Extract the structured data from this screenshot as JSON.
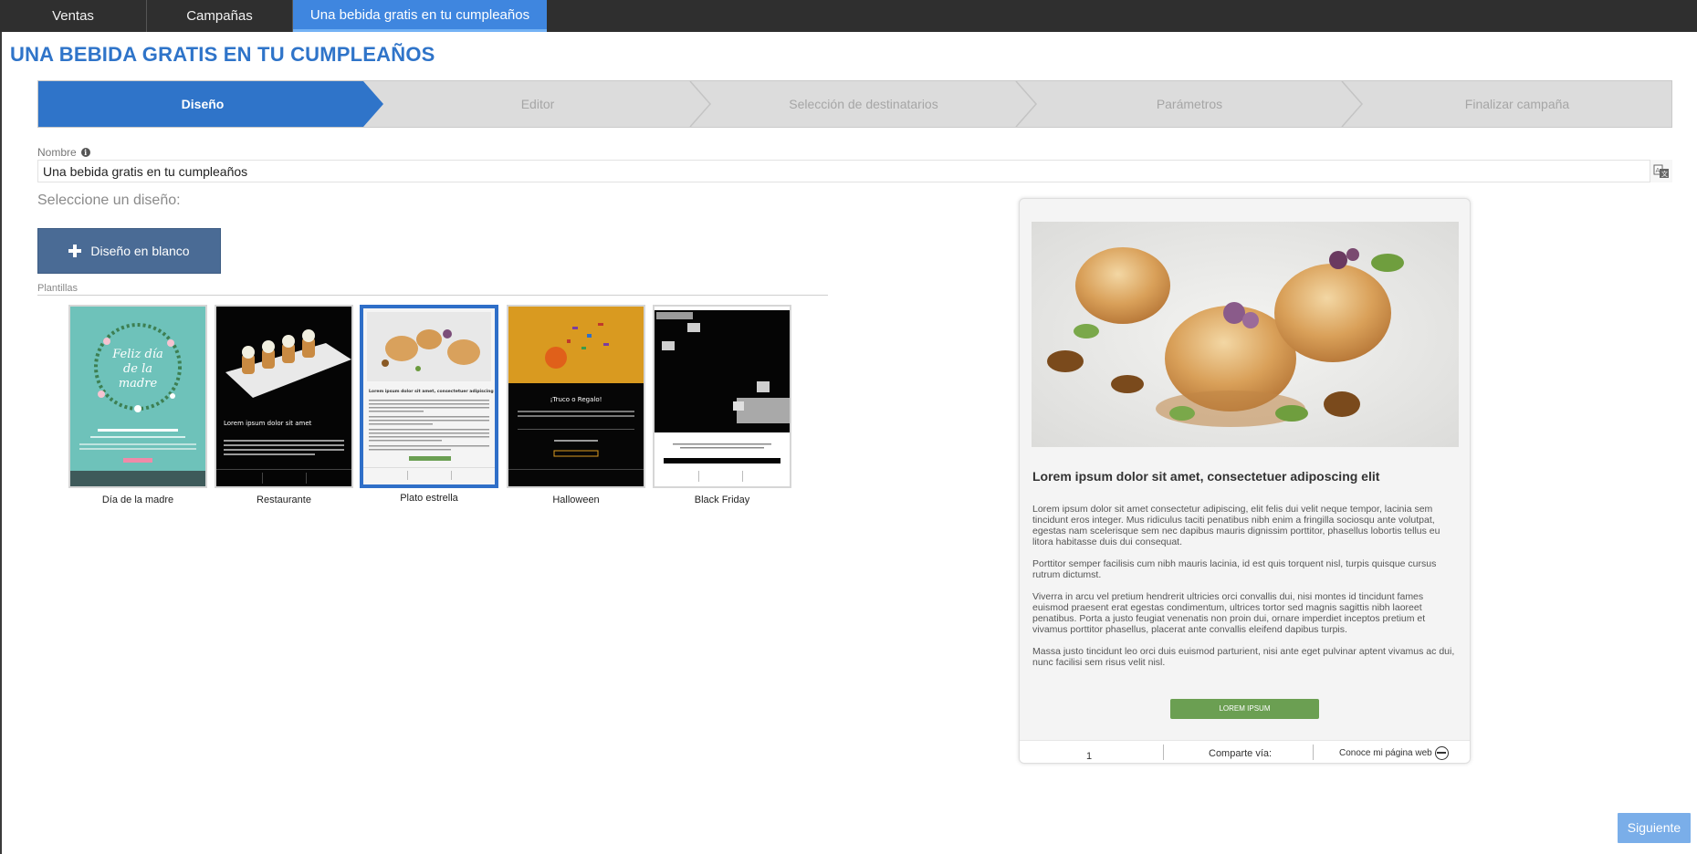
{
  "topbar": {
    "tabs": [
      {
        "label": "Ventas"
      },
      {
        "label": "Campañas"
      },
      {
        "label": "Una bebida gratis en tu cumpleaños"
      }
    ]
  },
  "page_title": "UNA BEBIDA GRATIS EN TU CUMPLEAÑOS",
  "steps": [
    {
      "label": "Diseño",
      "active": true
    },
    {
      "label": "Editor",
      "active": false
    },
    {
      "label": "Selección de destinatarios",
      "active": false
    },
    {
      "label": "Parámetros",
      "active": false
    },
    {
      "label": "Finalizar campaña",
      "active": false
    }
  ],
  "name_field": {
    "label": "Nombre",
    "value": "Una bebida gratis en tu cumpleaños"
  },
  "choose_label": "Seleccione un diseño:",
  "blank_design_label": "Diseño en blanco",
  "templates_label": "Plantillas",
  "templates": [
    {
      "caption": "Día de la madre",
      "selected": false,
      "thumb_title": "Feliz día de la madre",
      "thumb_heading": "LOREM IPSUM DOLOR SIT AMET"
    },
    {
      "caption": "Restaurante",
      "selected": false,
      "thumb_heading": "Lorem ipsum dolor sit amet"
    },
    {
      "caption": "Plato estrella",
      "selected": true,
      "thumb_heading": "Lorem ipsum dolor sit amet, consectetuer adipiscing elit"
    },
    {
      "caption": "Halloween",
      "selected": false,
      "thumb_heading": "¡Truco o Regalo!"
    },
    {
      "caption": "Black Friday",
      "selected": false
    }
  ],
  "preview": {
    "headline": "Lorem ipsum dolor sit amet, consectetuer adiposcing elit",
    "paragraphs": [
      "Lorem ipsum dolor sit amet consectetur adipiscing, elit felis dui velit neque tempor, lacinia sem tincidunt eros integer. Mus ridiculus taciti penatibus nibh enim a fringilla sociosqu ante volutpat, egestas nam scelerisque sem nec dapibus mauris dignissim porttitor, phasellus lobortis tellus eu litora habitasse duis dui consequat.",
      "Porttitor semper facilisis cum nibh mauris lacinia, id est quis torquent nisl, turpis quisque cursus rutrum dictumst.",
      "Viverra in arcu vel pretium hendrerit ultricies orci convallis dui, nisi montes id tincidunt fames euismod praesent erat egestas condimentum, ultrices tortor sed magnis sagittis nibh laoreet penatibus. Porta a justo feugiat venenatis non proin dui, ornare imperdiet inceptos pretium et vivamus porttitor phasellus, placerat ante convallis eleifend dapibus turpis.",
      "Massa justo tincidunt leo orci duis euismod parturient, nisi ante eget pulvinar aptent vivamus ac dui, nunc facilisi sem risus velit nisl."
    ],
    "cta_label": "LOREM IPSUM",
    "footer": {
      "left": "1",
      "share": "Comparte vía:",
      "web": "Conoce mi página web"
    }
  },
  "next_button": "Siguiente",
  "colors": {
    "accent": "#3f86df",
    "title": "#2f74c9",
    "step_active": "#2f74c9",
    "blank_button": "#4a6b95",
    "next_button": "#7aaee9",
    "cta": "#6b9f52"
  },
  "icons": {
    "info": "info-icon",
    "translate": "translate-icon",
    "plus": "plus-icon",
    "globe": "globe-icon"
  }
}
